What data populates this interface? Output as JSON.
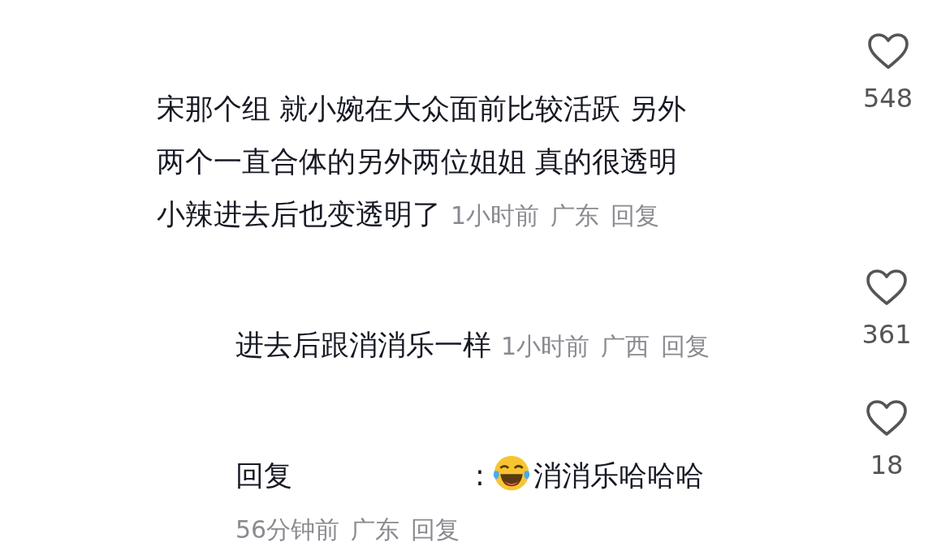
{
  "comments": [
    {
      "lines": [
        "宋那个组 就小婉在大众面前比较活跃 另外",
        "两个一直合体的另外两位姐姐 真的很透明",
        "小辣进去后也变透明了"
      ],
      "time": "1小时前",
      "location": "广东",
      "reply_action": "回复",
      "likes": "548",
      "liked": false,
      "children": [
        {
          "lines": [
            "进去后跟消消乐一样"
          ],
          "time": "1小时前",
          "location": "广西",
          "reply_action": "回复",
          "likes": "361",
          "liked": false
        },
        {
          "reply_to": {
            "label": "回复",
            "separator": ":"
          },
          "lines": [
            "消消乐哈哈哈"
          ],
          "time": "56分钟前",
          "location": "广东",
          "reply_action": "回复",
          "likes": "18",
          "liked": false
        }
      ]
    }
  ]
}
